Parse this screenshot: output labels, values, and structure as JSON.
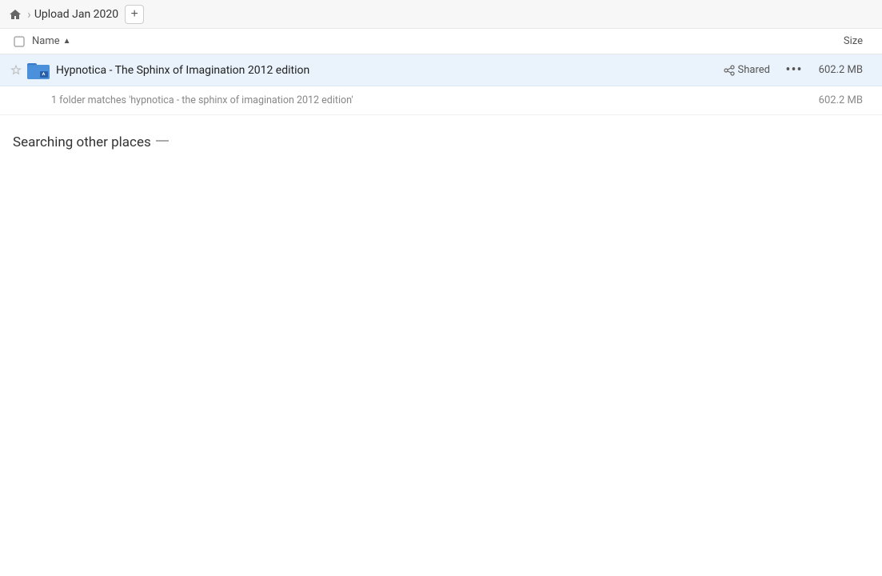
{
  "header": {
    "breadcrumb_title": "Upload Jan 2020",
    "add_button_label": "+",
    "home_icon": "home"
  },
  "columns": {
    "name_label": "Name",
    "size_label": "Size",
    "sort_arrow": "▲"
  },
  "file_row": {
    "name": "Hypnotica - The Sphinx of Imagination 2012 edition",
    "shared_label": "Shared",
    "more_label": "•••",
    "size": "602.2 MB"
  },
  "match_info": {
    "text": "1 folder matches 'hypnotica - the sphinx of imagination 2012 edition'",
    "size": "602.2 MB"
  },
  "searching": {
    "label": "Searching other places"
  }
}
